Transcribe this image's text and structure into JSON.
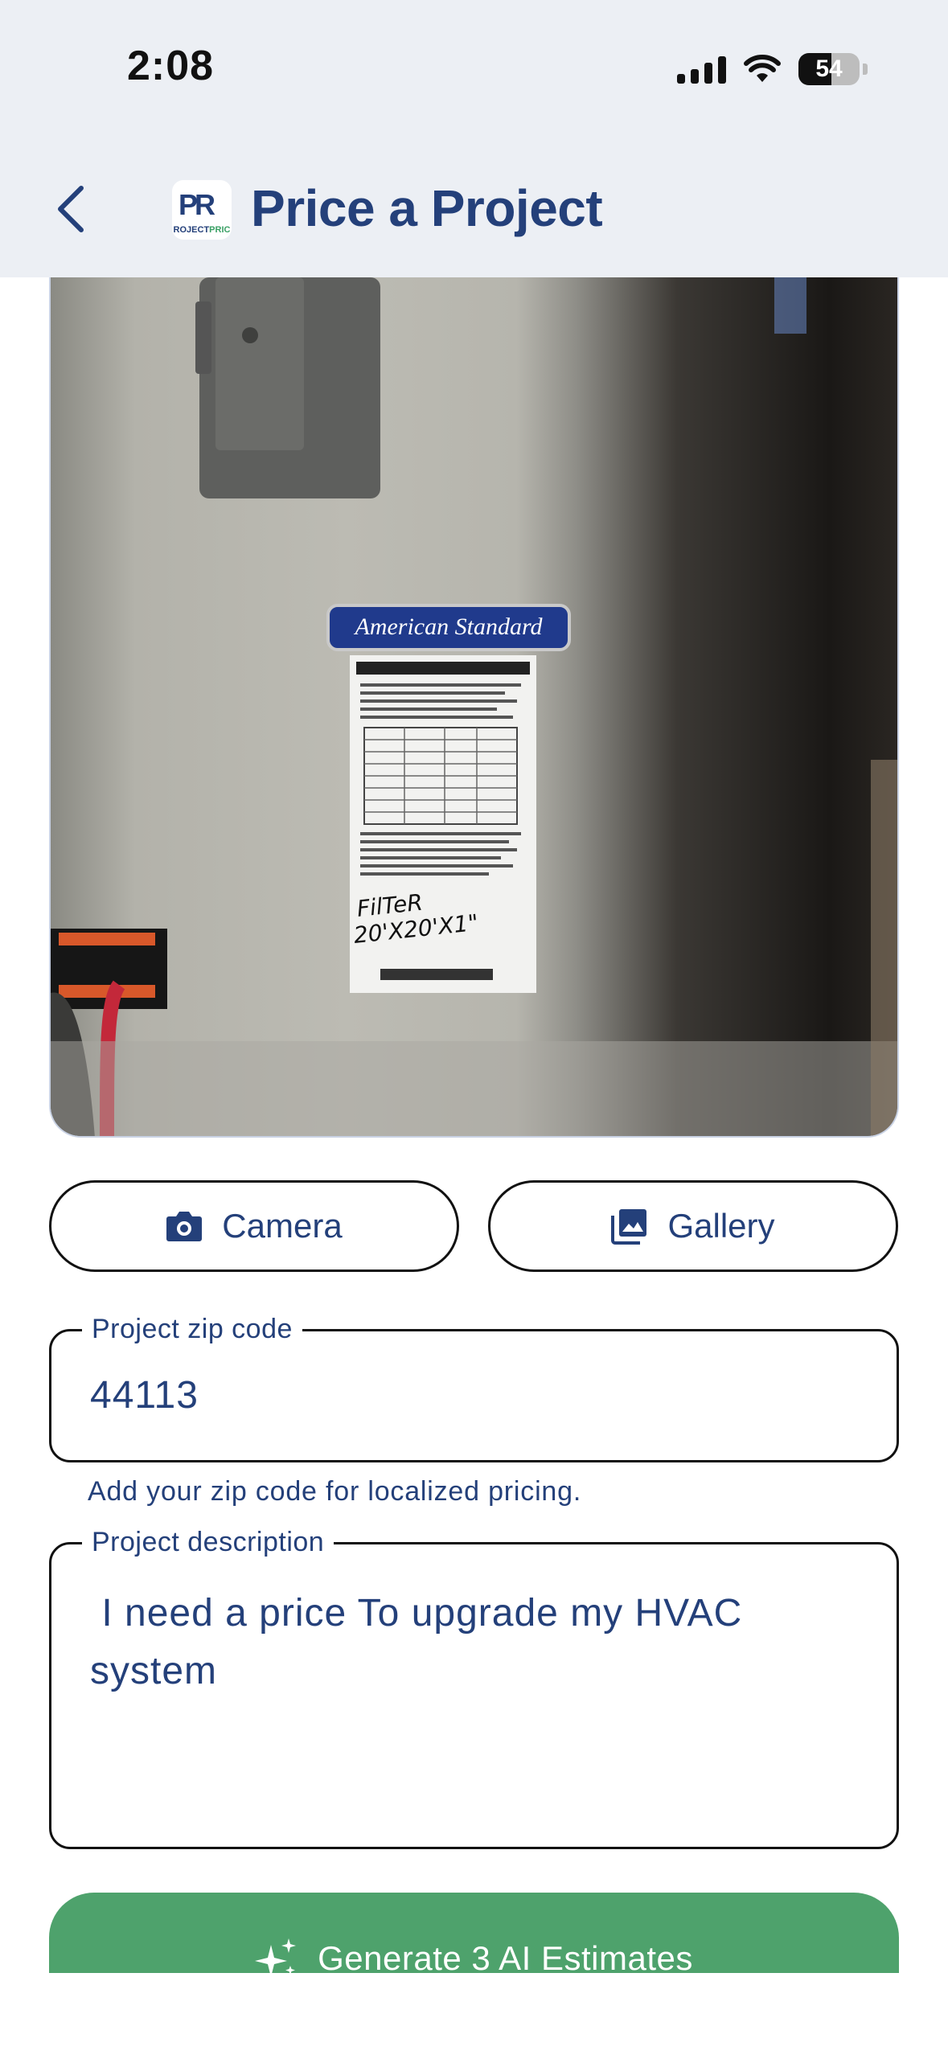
{
  "status_bar": {
    "time": "2:08",
    "battery": "54"
  },
  "header": {
    "title": "Price a Project",
    "logo_mark": "PR",
    "logo_text_a": "ROJECT",
    "logo_text_b": "PRIC"
  },
  "photo": {
    "label_brand": "American Standard",
    "label_note_1": "FilTeR",
    "label_note_2": "20'X20'X1\""
  },
  "actions": {
    "camera_label": "Camera",
    "gallery_label": "Gallery"
  },
  "zip": {
    "label": "Project zip code",
    "value": "44113",
    "helper": "Add your zip code for localized pricing."
  },
  "description": {
    "label": "Project description",
    "value": " I need a price To upgrade my HVAC system"
  },
  "submit": {
    "label": "Generate 3 AI Estimates"
  },
  "colors": {
    "brand_blue": "#24407a",
    "brand_green": "#4ea26c",
    "header_bg": "#eceff4"
  }
}
